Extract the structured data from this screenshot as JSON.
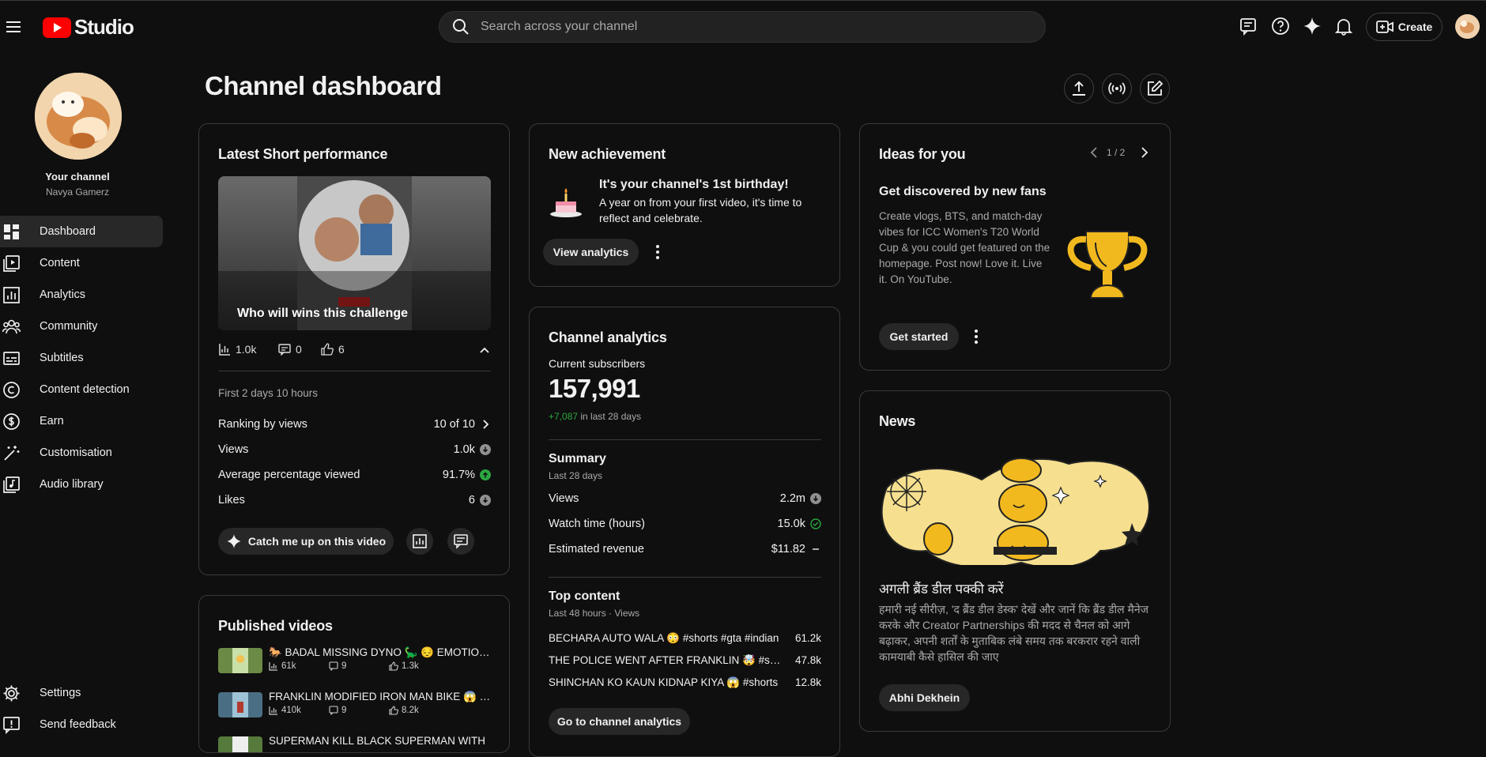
{
  "header": {
    "logo_text": "Studio",
    "search_placeholder": "Search across your channel",
    "create_label": "Create"
  },
  "sidebar": {
    "your_channel": "Your channel",
    "channel_name": "Navya Gamerz",
    "items": [
      {
        "label": "Dashboard",
        "icon": "dashboard-icon"
      },
      {
        "label": "Content",
        "icon": "content-icon"
      },
      {
        "label": "Analytics",
        "icon": "analytics-icon"
      },
      {
        "label": "Community",
        "icon": "community-icon"
      },
      {
        "label": "Subtitles",
        "icon": "subtitles-icon"
      },
      {
        "label": "Content detection",
        "icon": "copyright-icon"
      },
      {
        "label": "Earn",
        "icon": "dollar-icon"
      },
      {
        "label": "Customisation",
        "icon": "magic-wand-icon"
      },
      {
        "label": "Audio library",
        "icon": "music-icon"
      }
    ],
    "settings": "Settings",
    "feedback": "Send feedback"
  },
  "page": {
    "title": "Channel dashboard"
  },
  "latest_short": {
    "title": "Latest Short performance",
    "video_title": "Who will wins this challenge",
    "views": "1.0k",
    "comments": "0",
    "likes": "6",
    "period": "First 2 days 10 hours",
    "metrics": [
      {
        "label": "Ranking by views",
        "value": "10 of 10"
      },
      {
        "label": "Views",
        "value": "1.0k"
      },
      {
        "label": "Average percentage viewed",
        "value": "91.7%"
      },
      {
        "label": "Likes",
        "value": "6"
      }
    ],
    "catch_me": "Catch me up on this video"
  },
  "published": {
    "title": "Published videos",
    "videos": [
      {
        "title": "🐎 BADAL MISSING DYNO 🦕 😔 EMOTIONAL",
        "views": "61k",
        "comments": "9",
        "likes": "1.3k"
      },
      {
        "title": "FRANKLIN MODIFIED IRON MAN BIKE 😱 #shorts",
        "views": "410k",
        "comments": "9",
        "likes": "8.2k"
      },
      {
        "title": "SUPERMAN KILL BLACK SUPERMAN WITH",
        "views": "",
        "comments": "",
        "likes": ""
      }
    ]
  },
  "achievement": {
    "title": "New achievement",
    "heading": "It's your channel's 1st birthday!",
    "body": "A year on from your first video, it's time to reflect and celebrate.",
    "button": "View analytics"
  },
  "analytics": {
    "title": "Channel analytics",
    "subs_label": "Current subscribers",
    "subs": "157,991",
    "change": "+7,087",
    "change_suffix": " in last 28 days",
    "summary_title": "Summary",
    "summary_period": "Last 28 days",
    "summary": [
      {
        "label": "Views",
        "value": "2.2m"
      },
      {
        "label": "Watch time (hours)",
        "value": "15.0k"
      },
      {
        "label": "Estimated revenue",
        "value": "$11.82"
      }
    ],
    "top_title": "Top content",
    "top_period": "Last 48 hours · Views",
    "top": [
      {
        "title": "BECHARA AUTO WALA 😳 #shorts #gta #indian",
        "views": "61.2k"
      },
      {
        "title": "THE POLICE WENT AFTER FRANKLIN 🤯 #shorts",
        "views": "47.8k"
      },
      {
        "title": "SHINCHAN KO KAUN KIDNAP KIYA 😱 #shorts",
        "views": "12.8k"
      }
    ],
    "button": "Go to channel analytics"
  },
  "ideas": {
    "title": "Ideas for you",
    "pager": "1 / 2",
    "heading": "Get discovered by new fans",
    "body": "Create vlogs, BTS, and match-day vibes for ICC Women's T20 World Cup & you could get featured on the homepage. Post now! Love it. Live it. On YouTube.",
    "button": "Get started"
  },
  "news": {
    "title": "News",
    "heading": "अगली ब्रैंड डील पक्की करें",
    "body": "हमारी नई सीरीज़, 'द ब्रैंड डील डेस्क' देखें और जानें कि ब्रैंड डील मैनेज करके और Creator Partnerships की मदद से चैनल को आगे बढ़ाकर, अपनी शर्तों के मुताबिक लंबे समय तक बरकरार रहने वाली कामयाबी कैसे हासिल की जाए",
    "button": "Abhi Dekhein"
  },
  "colors": {
    "bg": "#0f0f0f",
    "card": "#0f0f0f",
    "border": "#3a3a3a",
    "accent_red": "#ff0000",
    "green": "#2ba640",
    "gold": "#f2b91e"
  }
}
